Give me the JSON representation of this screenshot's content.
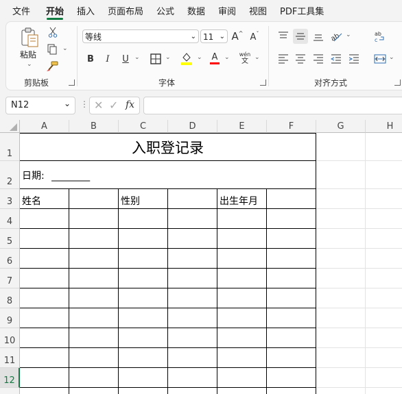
{
  "menu": {
    "items": [
      "文件",
      "开始",
      "插入",
      "页面布局",
      "公式",
      "数据",
      "审阅",
      "视图",
      "PDF工具集"
    ],
    "active": "开始"
  },
  "ribbon": {
    "clipboard": {
      "paste_label": "粘贴",
      "group_label": "剪贴板"
    },
    "font": {
      "font_name": "等线",
      "font_size": "11",
      "bold": "B",
      "italic": "I",
      "underline": "U",
      "font_color_glyph": "A",
      "phonetic_top": "wén",
      "phonetic_bottom": "文",
      "grow": "A",
      "shrink": "A",
      "group_label": "字体",
      "fill_color": "#ffff00",
      "font_color": "#ff0000"
    },
    "alignment": {
      "group_label": "对齐方式"
    }
  },
  "formula_bar": {
    "name_box": "N12",
    "fx": "fx",
    "value": ""
  },
  "columns": [
    "A",
    "B",
    "C",
    "D",
    "E",
    "F",
    "G",
    "H"
  ],
  "rows": [
    "1",
    "2",
    "3",
    "4",
    "5",
    "6",
    "7",
    "8",
    "9",
    "10",
    "11",
    "12"
  ],
  "selected_row": "12",
  "sheet": {
    "title": "入职登记录",
    "date_label": "日期:",
    "date_blank": "________",
    "headers": {
      "name": "姓名",
      "gender": "性别",
      "birth": "出生年月"
    }
  },
  "accent_color": "#107c41"
}
